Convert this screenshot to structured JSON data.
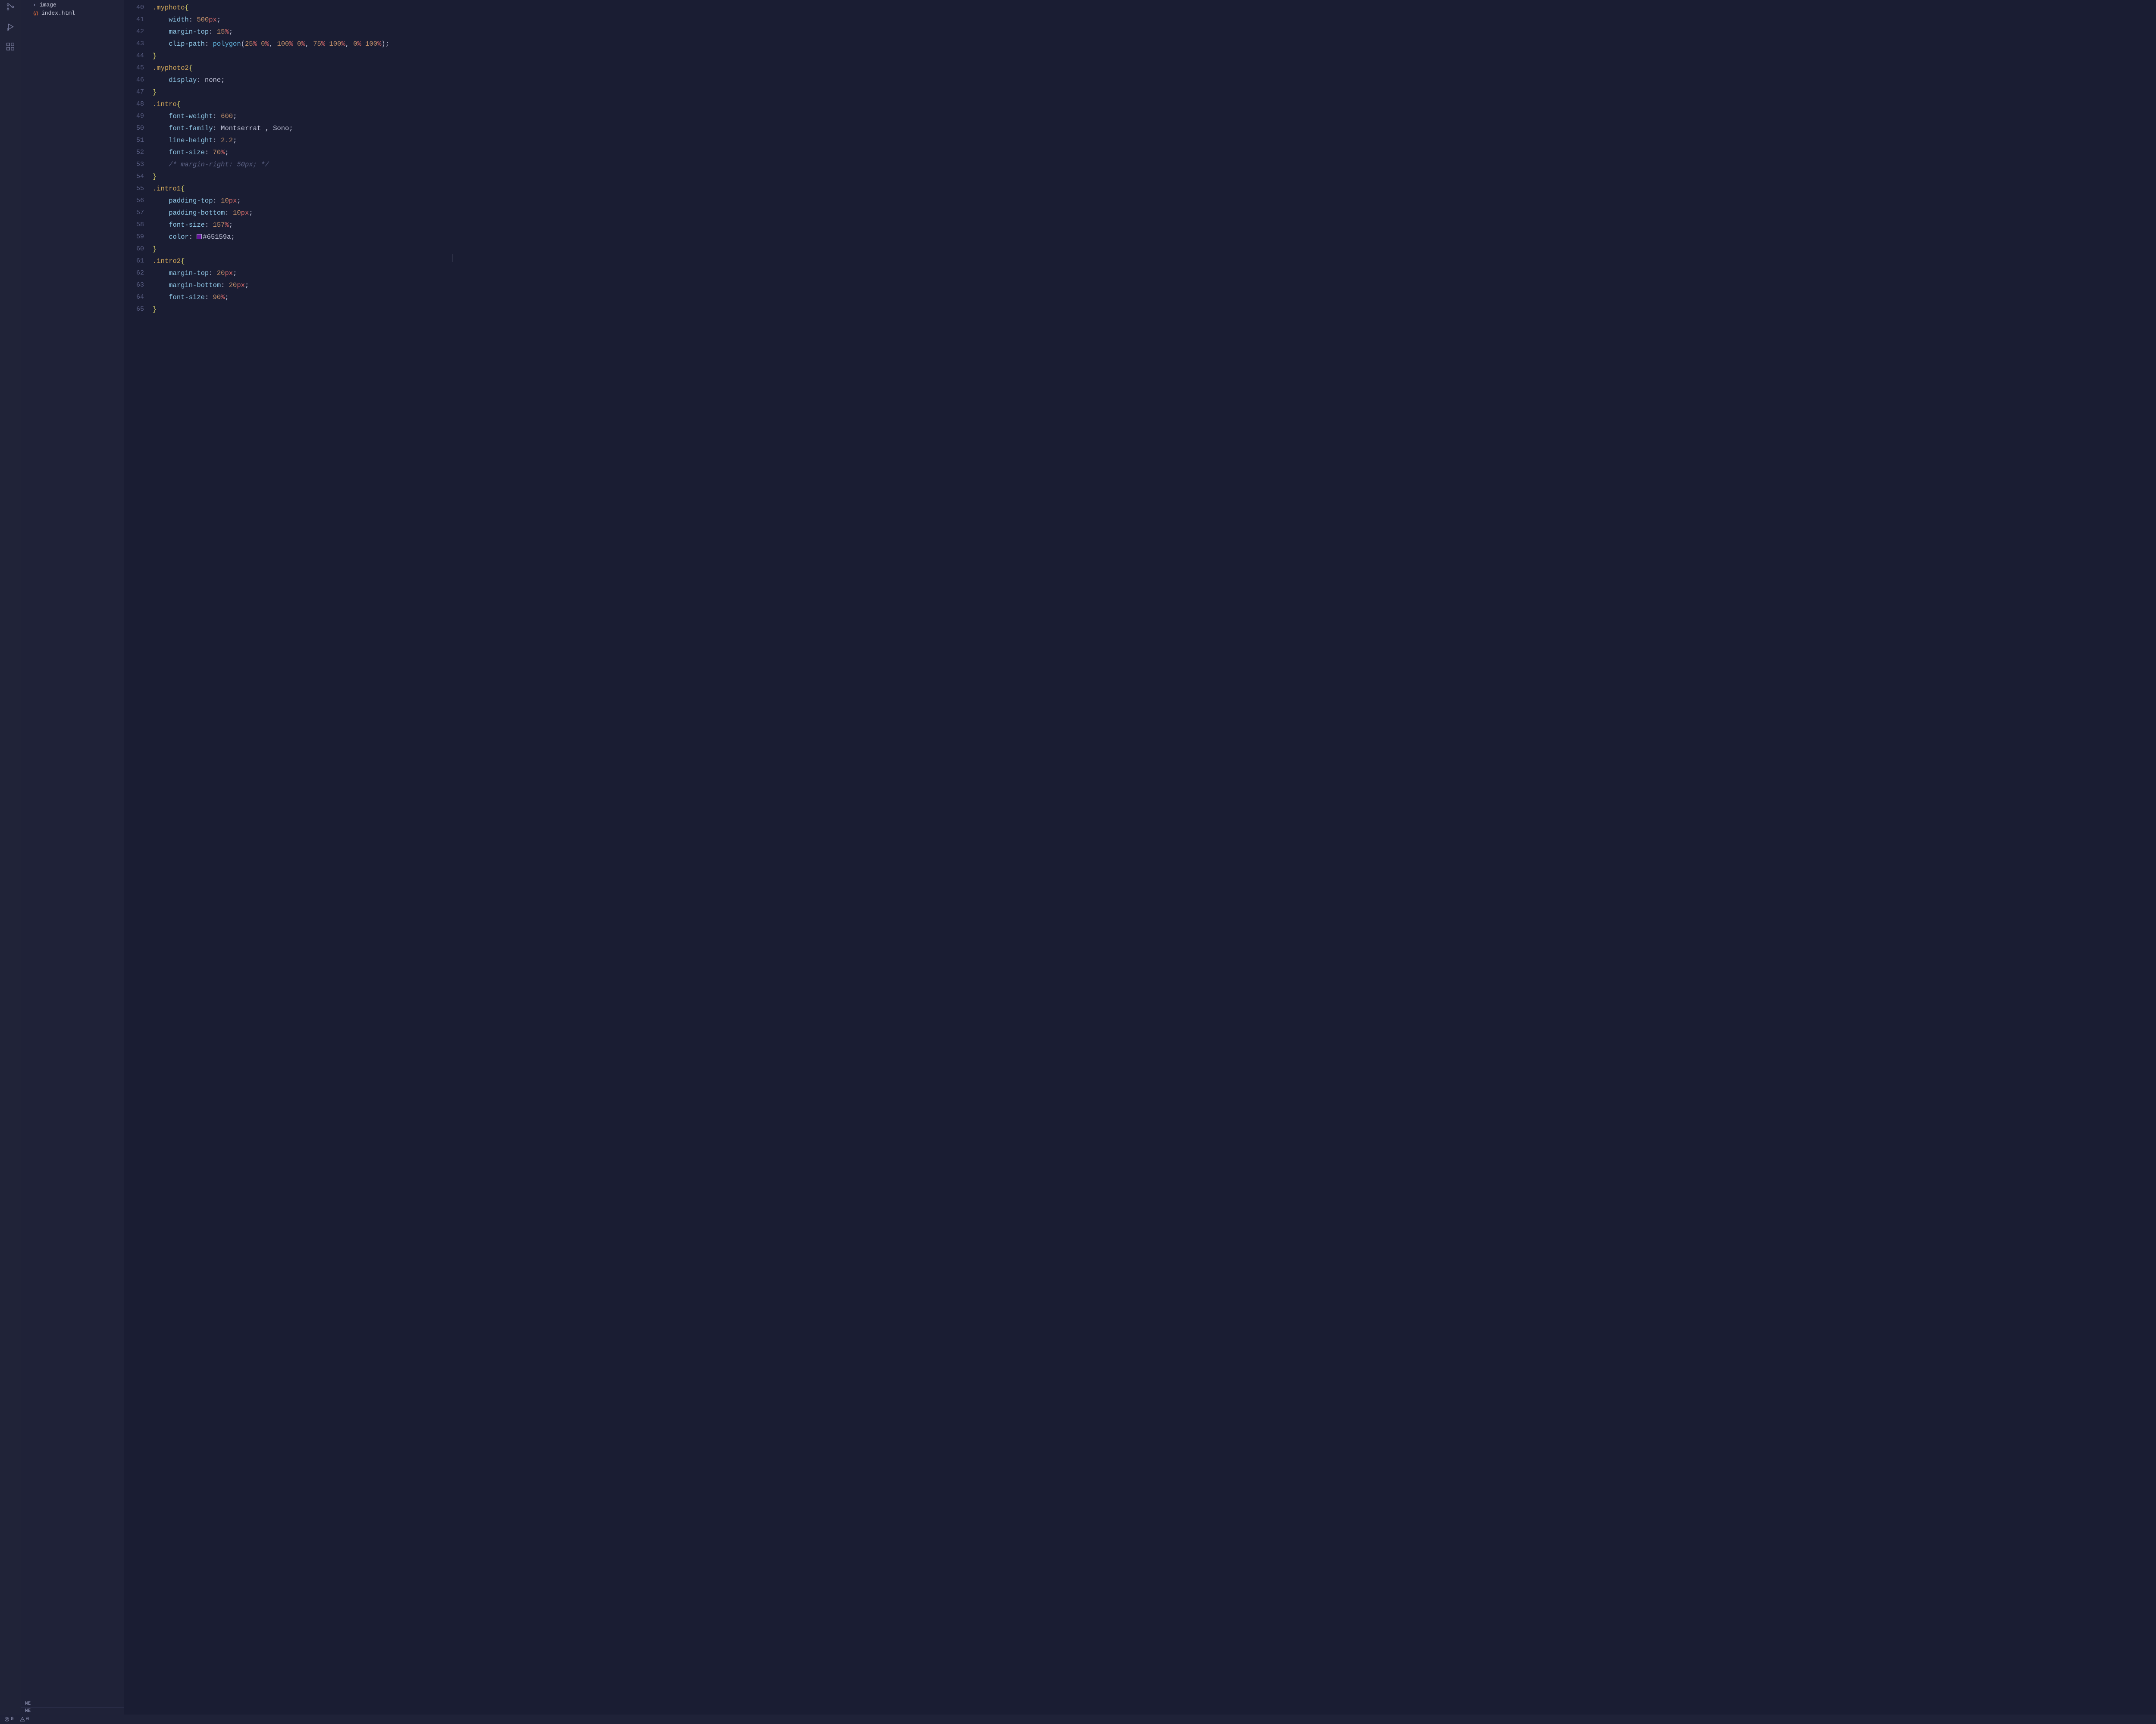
{
  "activitybar": {
    "icons": [
      "source-control-icon",
      "run-debug-icon",
      "extensions-icon"
    ]
  },
  "sidebar": {
    "items": [
      {
        "type": "folder",
        "label": "image"
      },
      {
        "type": "file",
        "label": "index.html",
        "icon": "html-file-icon",
        "iconColor": "#e06c3a"
      }
    ]
  },
  "outline": {
    "rows": [
      "NE",
      "NE"
    ]
  },
  "statusbar": {
    "errors": "0",
    "warnings": "0"
  },
  "editor": {
    "gutter_start": 40,
    "gutter_end": 65,
    "lines": [
      {
        "n": 40,
        "tokens": [
          {
            "t": "sel",
            "v": ".myphoto"
          },
          {
            "t": "brace",
            "v": "{"
          }
        ]
      },
      {
        "n": 41,
        "indent": 1,
        "tokens": [
          {
            "t": "prop",
            "v": "width"
          },
          {
            "t": "punc",
            "v": ": "
          },
          {
            "t": "num",
            "v": "500"
          },
          {
            "t": "unit",
            "v": "px"
          },
          {
            "t": "punc",
            "v": ";"
          }
        ]
      },
      {
        "n": 42,
        "indent": 1,
        "tokens": [
          {
            "t": "prop",
            "v": "margin-top"
          },
          {
            "t": "punc",
            "v": ": "
          },
          {
            "t": "num",
            "v": "15"
          },
          {
            "t": "unit",
            "v": "%"
          },
          {
            "t": "punc",
            "v": ";"
          }
        ]
      },
      {
        "n": 43,
        "indent": 1,
        "tokens": [
          {
            "t": "prop",
            "v": "clip-path"
          },
          {
            "t": "punc",
            "v": ": "
          },
          {
            "t": "func",
            "v": "polygon"
          },
          {
            "t": "punc",
            "v": "("
          },
          {
            "t": "num",
            "v": "25"
          },
          {
            "t": "unit",
            "v": "% "
          },
          {
            "t": "num",
            "v": "0"
          },
          {
            "t": "unit",
            "v": "%"
          },
          {
            "t": "punc",
            "v": ", "
          },
          {
            "t": "num",
            "v": "100"
          },
          {
            "t": "unit",
            "v": "% "
          },
          {
            "t": "num",
            "v": "0"
          },
          {
            "t": "unit",
            "v": "%"
          },
          {
            "t": "punc",
            "v": ", "
          },
          {
            "t": "num",
            "v": "75"
          },
          {
            "t": "unit",
            "v": "% "
          },
          {
            "t": "num",
            "v": "100"
          },
          {
            "t": "unit",
            "v": "%"
          },
          {
            "t": "punc",
            "v": ", "
          },
          {
            "t": "num",
            "v": "0"
          },
          {
            "t": "unit",
            "v": "% "
          },
          {
            "t": "num",
            "v": "100"
          },
          {
            "t": "unit",
            "v": "%"
          },
          {
            "t": "punc",
            "v": ");"
          }
        ]
      },
      {
        "n": 44,
        "tokens": [
          {
            "t": "brace",
            "v": "}"
          }
        ]
      },
      {
        "n": 45,
        "tokens": [
          {
            "t": "sel",
            "v": ".myphoto2"
          },
          {
            "t": "brace",
            "v": "{"
          }
        ]
      },
      {
        "n": 46,
        "indent": 1,
        "tokens": [
          {
            "t": "prop",
            "v": "display"
          },
          {
            "t": "punc",
            "v": ": "
          },
          {
            "t": "none",
            "v": "none"
          },
          {
            "t": "punc",
            "v": ";"
          }
        ]
      },
      {
        "n": 47,
        "tokens": [
          {
            "t": "brace",
            "v": "}"
          }
        ]
      },
      {
        "n": 48,
        "tokens": [
          {
            "t": "sel",
            "v": ".intro"
          },
          {
            "t": "brace",
            "v": "{"
          }
        ]
      },
      {
        "n": 49,
        "indent": 1,
        "tokens": [
          {
            "t": "prop",
            "v": "font-weight"
          },
          {
            "t": "punc",
            "v": ": "
          },
          {
            "t": "num",
            "v": "600"
          },
          {
            "t": "punc",
            "v": ";"
          }
        ]
      },
      {
        "n": 50,
        "indent": 1,
        "tokens": [
          {
            "t": "prop",
            "v": "font-family"
          },
          {
            "t": "punc",
            "v": ": "
          },
          {
            "t": "str",
            "v": "Montserrat , Sono"
          },
          {
            "t": "punc",
            "v": ";"
          }
        ]
      },
      {
        "n": 51,
        "indent": 1,
        "tokens": [
          {
            "t": "prop",
            "v": "line-height"
          },
          {
            "t": "punc",
            "v": ": "
          },
          {
            "t": "num",
            "v": "2.2"
          },
          {
            "t": "punc",
            "v": ";"
          }
        ]
      },
      {
        "n": 52,
        "indent": 1,
        "tokens": [
          {
            "t": "prop",
            "v": "font-size"
          },
          {
            "t": "punc",
            "v": ": "
          },
          {
            "t": "num",
            "v": "70"
          },
          {
            "t": "unit",
            "v": "%"
          },
          {
            "t": "punc",
            "v": ";"
          }
        ]
      },
      {
        "n": 53,
        "indent": 1,
        "tokens": [
          {
            "t": "cmt",
            "v": "/* margin-right: 50px; */"
          }
        ]
      },
      {
        "n": 54,
        "tokens": [
          {
            "t": "brace",
            "v": "}"
          }
        ]
      },
      {
        "n": 55,
        "tokens": [
          {
            "t": "sel",
            "v": ".intro1"
          },
          {
            "t": "brace",
            "v": "{"
          }
        ]
      },
      {
        "n": 56,
        "indent": 1,
        "tokens": [
          {
            "t": "prop",
            "v": "padding-top"
          },
          {
            "t": "punc",
            "v": ": "
          },
          {
            "t": "num",
            "v": "10"
          },
          {
            "t": "unit",
            "v": "px"
          },
          {
            "t": "punc",
            "v": ";"
          }
        ]
      },
      {
        "n": 57,
        "indent": 1,
        "tokens": [
          {
            "t": "prop",
            "v": "padding-bottom"
          },
          {
            "t": "punc",
            "v": ": "
          },
          {
            "t": "num",
            "v": "10"
          },
          {
            "t": "unit",
            "v": "px"
          },
          {
            "t": "punc",
            "v": ";"
          }
        ]
      },
      {
        "n": 58,
        "indent": 1,
        "tokens": [
          {
            "t": "prop",
            "v": "font-size"
          },
          {
            "t": "punc",
            "v": ": "
          },
          {
            "t": "num",
            "v": "157"
          },
          {
            "t": "unit",
            "v": "%"
          },
          {
            "t": "punc",
            "v": ";"
          }
        ]
      },
      {
        "n": 59,
        "indent": 1,
        "tokens": [
          {
            "t": "prop",
            "v": "color"
          },
          {
            "t": "punc",
            "v": ": "
          },
          {
            "t": "swatch",
            "v": "#65159a"
          },
          {
            "t": "str",
            "v": "#65159a"
          },
          {
            "t": "punc",
            "v": ";"
          }
        ]
      },
      {
        "n": 60,
        "tokens": [
          {
            "t": "brace",
            "v": "}"
          }
        ]
      },
      {
        "n": 61,
        "tokens": [
          {
            "t": "sel",
            "v": ".intro2"
          },
          {
            "t": "brace",
            "v": "{"
          }
        ]
      },
      {
        "n": 62,
        "indent": 1,
        "tokens": [
          {
            "t": "prop",
            "v": "margin-top"
          },
          {
            "t": "punc",
            "v": ": "
          },
          {
            "t": "num",
            "v": "20"
          },
          {
            "t": "unit",
            "v": "px"
          },
          {
            "t": "punc",
            "v": ";"
          }
        ]
      },
      {
        "n": 63,
        "indent": 1,
        "tokens": [
          {
            "t": "prop",
            "v": "margin-bottom"
          },
          {
            "t": "punc",
            "v": ": "
          },
          {
            "t": "num",
            "v": "20"
          },
          {
            "t": "unit",
            "v": "px"
          },
          {
            "t": "punc",
            "v": ";"
          }
        ]
      },
      {
        "n": 64,
        "indent": 1,
        "tokens": [
          {
            "t": "prop",
            "v": "font-size"
          },
          {
            "t": "punc",
            "v": ": "
          },
          {
            "t": "num",
            "v": "90"
          },
          {
            "t": "unit",
            "v": "%"
          },
          {
            "t": "punc",
            "v": ";"
          }
        ]
      },
      {
        "n": 65,
        "tokens": [
          {
            "t": "brace",
            "v": "}"
          }
        ]
      }
    ]
  },
  "caret": {
    "visible": true
  }
}
